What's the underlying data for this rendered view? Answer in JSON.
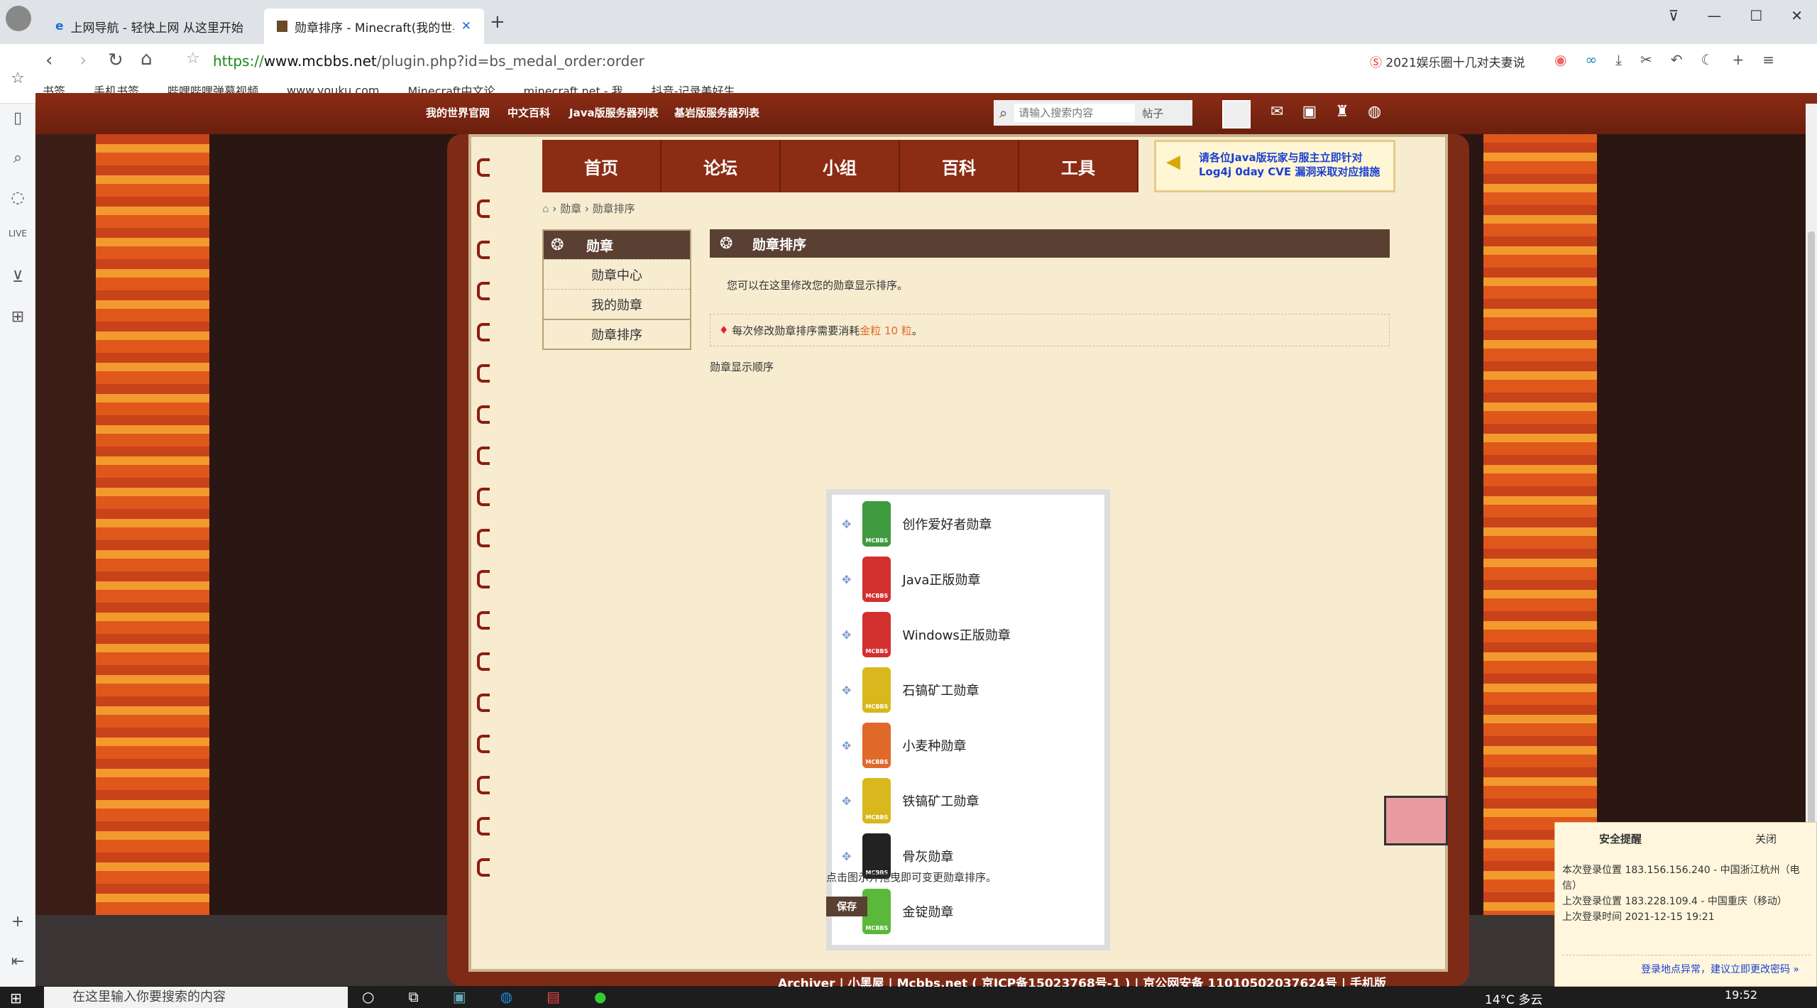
{
  "tabs": [
    {
      "label": "上网导航 - 轻快上网 从这里开始",
      "active": false
    },
    {
      "label": "勋章排序 - Minecraft(我的世界)中文",
      "active": true
    }
  ],
  "address": {
    "scheme": "https://",
    "host": "www.mcbbs.net",
    "path": "/plugin.php?id=bs_medal_order:order",
    "search_hint": "2021娱乐圈十几对夫妻说"
  },
  "bookmarks": [
    "书签",
    "手机书签",
    "哔哩哔哩弹幕视频",
    "www.youku.com",
    "Minecraft中文论",
    "minecraft.net - 我",
    "抖音-记录美好生"
  ],
  "site_topbar": {
    "links": [
      "我的世界官网",
      "中文百科",
      "Java版服务器列表",
      "基岩版服务器列表"
    ],
    "search_placeholder": "请输入搜索内容",
    "search_type": "帖子"
  },
  "main_nav": [
    "首页",
    "论坛",
    "小组",
    "百科",
    "工具"
  ],
  "notice": "请各位Java版玩家与服主立即针对Log4j 0day CVE 漏洞采取对应措施",
  "breadcrumb": [
    "勋章",
    "勋章排序"
  ],
  "sidebar": {
    "title": "勋章",
    "items": [
      "勋章中心",
      "我的勋章",
      "勋章排序"
    ]
  },
  "main": {
    "title": "勋章排序",
    "desc": "您可以在这里修改您的勋章显示排序。",
    "cost_prefix": "每次修改勋章排序需要消耗",
    "cost_value": "金粒 10 粒",
    "cost_suffix": "。",
    "order_label": "勋章显示顺序",
    "medals": [
      {
        "name": "创作爱好者勋章",
        "color": "#3e9a3e"
      },
      {
        "name": "Java正版勋章",
        "color": "#d33030"
      },
      {
        "name": "Windows正版勋章",
        "color": "#d33030"
      },
      {
        "name": "石镐矿工勋章",
        "color": "#d8b81c"
      },
      {
        "name": "小麦种勋章",
        "color": "#e0692a"
      },
      {
        "name": "铁镐矿工勋章",
        "color": "#d8b81c"
      },
      {
        "name": "骨灰勋章",
        "color": "#222222"
      },
      {
        "name": "金锭勋章",
        "color": "#5ab83a"
      }
    ],
    "medal_tag": "MCBBS",
    "hint": "点击图示并拖曳即可变更勋章排序。",
    "save": "保存"
  },
  "footer": "Archiver | 小黑屋 | Mcbbs.net ( 京ICP备15023768号-1 ) | 京公网安备 11010502037624号 | 手机版",
  "security_popup": {
    "title": "安全提醒",
    "close": "关闭",
    "lines": [
      "本次登录位置 183.156.156.240 - 中国浙江杭州（电信）",
      "上次登录位置 183.228.109.4 - 中国重庆（移动）",
      "上次登录时间 2021-12-15 19:21"
    ],
    "link": "登录地点异常，建议立即更改密码 »"
  },
  "taskbar": {
    "search": "在这里输入你要搜索的内容",
    "weather": "14°C 多云",
    "time": "19:52"
  }
}
